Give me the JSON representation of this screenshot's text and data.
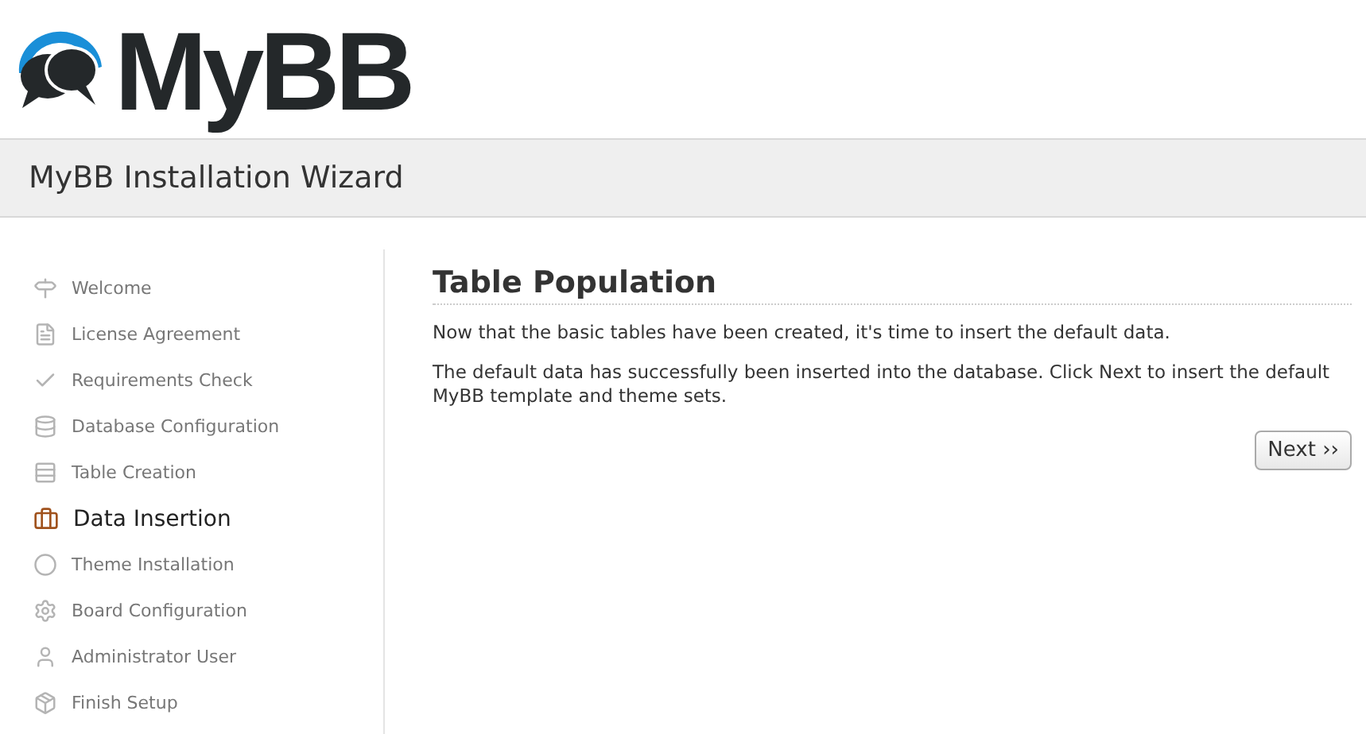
{
  "logo": {
    "text": "MyBB"
  },
  "header": {
    "title": "MyBB Installation Wizard"
  },
  "steps": [
    {
      "label": "Welcome",
      "kind": "signpost",
      "selected": false
    },
    {
      "label": "License Agreement",
      "kind": "document",
      "selected": false
    },
    {
      "label": "Requirements Check",
      "kind": "check",
      "selected": false
    },
    {
      "label": "Database Configuration",
      "kind": "database",
      "selected": false
    },
    {
      "label": "Table Creation",
      "kind": "table",
      "selected": false
    },
    {
      "label": "Data Insertion",
      "kind": "briefcase",
      "selected": true
    },
    {
      "label": "Theme Installation",
      "kind": "circle",
      "selected": false
    },
    {
      "label": "Board Configuration",
      "kind": "gear",
      "selected": false
    },
    {
      "label": "Administrator User",
      "kind": "user",
      "selected": false
    },
    {
      "label": "Finish Setup",
      "kind": "package",
      "selected": false
    }
  ],
  "content": {
    "title": "Table Population",
    "paragraphs": [
      "Now that the basic tables have been created, it's time to insert the default data.",
      "The default data has successfully been inserted into the database. Click Next to insert the default MyBB template and theme sets."
    ],
    "next_button": "Next ››"
  }
}
